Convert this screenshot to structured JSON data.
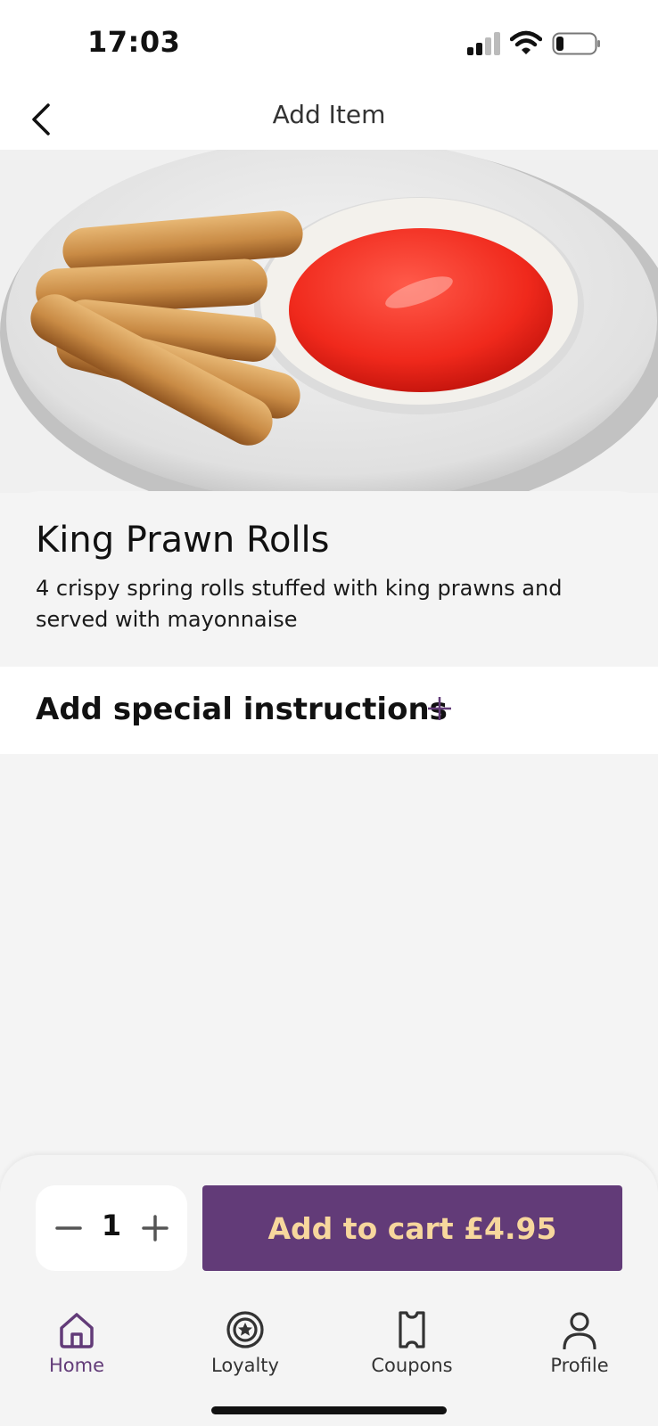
{
  "status_bar": {
    "time": "17:03",
    "icons": [
      "signal-icon",
      "wifi-icon",
      "battery-icon"
    ]
  },
  "header": {
    "title": "Add Item",
    "back_icon": "chevron-left-icon"
  },
  "item": {
    "name": "King Prawn Rolls",
    "description": "4 crispy spring rolls stuffed with king prawns and served with mayonnaise",
    "image": "spring-rolls-with-sweet-chili-sauce"
  },
  "instructions": {
    "label": "Add special instructions",
    "icon": "plus-icon"
  },
  "cart": {
    "quantity": "1",
    "add_label": "Add to cart £4.95"
  },
  "tabs": [
    {
      "label": "Home",
      "icon": "home-icon",
      "active": true
    },
    {
      "label": "Loyalty",
      "icon": "loyalty-badge-icon",
      "active": false
    },
    {
      "label": "Coupons",
      "icon": "coupon-icon",
      "active": false
    },
    {
      "label": "Profile",
      "icon": "profile-icon",
      "active": false
    }
  ],
  "colors": {
    "accent": "#623b78",
    "button_text": "#f7d79d",
    "background": "#f4f4f4"
  }
}
